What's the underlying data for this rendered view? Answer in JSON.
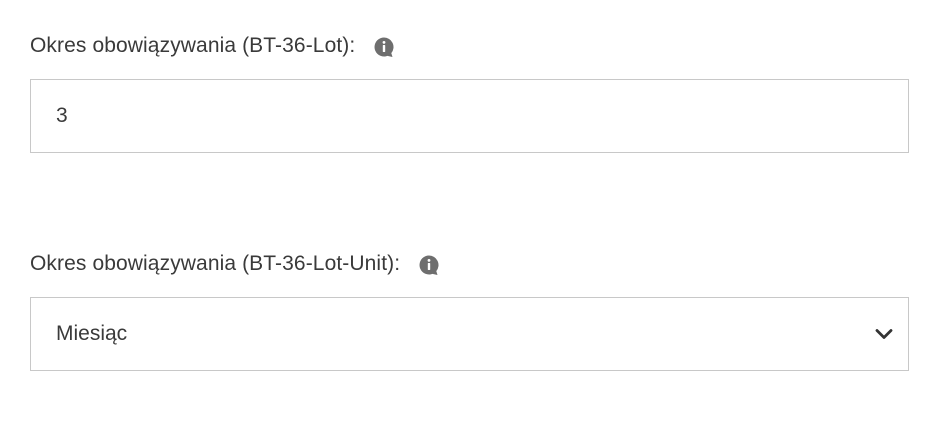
{
  "period_lot": {
    "label": "Okres obowiązywania (BT-36-Lot):",
    "value": "3",
    "icon": "info-icon"
  },
  "period_unit": {
    "label": "Okres obowiązywania (BT-36-Lot-Unit):",
    "selected": "Miesiąc",
    "icon": "info-icon",
    "dropdown_icon": "chevron-down-icon"
  },
  "colors": {
    "border": "#c8c8c8",
    "text": "#3a3a3a",
    "icon": "#6e6e6e"
  }
}
